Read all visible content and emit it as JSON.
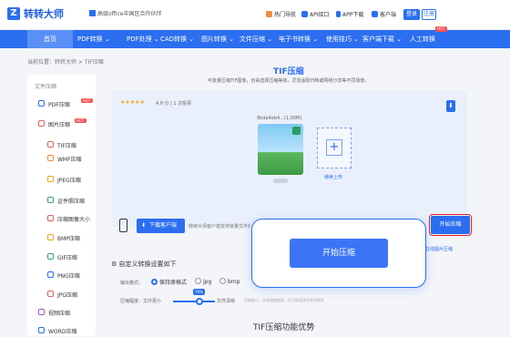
{
  "topbar": {
    "logo_text": "转转大师",
    "partner_text": "高级office中国区合作伙伴",
    "links": [
      "热门导航",
      "API接口",
      "APP下载",
      "客户端"
    ],
    "login": "登录",
    "register": "注册"
  },
  "nav": {
    "items": [
      "首页",
      "PDF转换",
      "PDF处理",
      "CAD转换",
      "图片转换",
      "文件压缩",
      "电子书转换",
      "使用技巧",
      "客户端下载",
      "人工转换"
    ],
    "hot_badge": "HOT"
  },
  "breadcrumb": "当前位置：转转大师 > TIF压缩",
  "sidebar": {
    "head": "文件压缩",
    "items": [
      {
        "label": "PDF压缩",
        "badge": "HOT",
        "color": "#2b6ef0"
      },
      {
        "label": "图片压缩",
        "badge": "HOT",
        "color": "#e0605a"
      },
      {
        "label": "TIF压缩",
        "badge": "",
        "color": "#e0605a"
      },
      {
        "label": "WMF压缩",
        "badge": "",
        "color": "#f08c3c"
      },
      {
        "label": "JPEG压缩",
        "badge": "",
        "color": "#f0a41c"
      },
      {
        "label": "证件照压缩",
        "badge": "",
        "color": "#2aa876"
      },
      {
        "label": "压缩图像大小",
        "badge": "",
        "color": "#e0605a"
      },
      {
        "label": "BMP压缩",
        "badge": "",
        "color": "#f0a41c"
      },
      {
        "label": "GIF压缩",
        "badge": "",
        "color": "#2aa876"
      },
      {
        "label": "PNG压缩",
        "badge": "",
        "color": "#2b6ef0"
      },
      {
        "label": "JPG压缩",
        "badge": "",
        "color": "#e0605a"
      },
      {
        "label": "视频压缩",
        "badge": "",
        "color": "#9b59d6"
      },
      {
        "label": "WORD压缩",
        "badge": "",
        "color": "#2b6ef0"
      }
    ]
  },
  "main": {
    "title": "TIF压缩",
    "subtitle": "可批量压缩TIF图像，自由选择压缩等级，灵活适配归档或网络分享等不同场景。",
    "stars": "★★★★★",
    "rating": "4.9 分 | 1 次投票",
    "file_name": "8bda4eb4...(1.00M)",
    "add_label": "继续上传",
    "download_client": "下载客户端",
    "download_desc": "转转大师客户端支持批量文件处理",
    "start_small": "开始压缩",
    "side_link": "在线图片压缩",
    "start_big": "开始压缩",
    "settings_title": "自定义转换设置如下",
    "format_label": "输出格式：",
    "format_options": [
      "保持原格式",
      "jpg",
      "bmp"
    ],
    "selected_format": "保持原格式",
    "level_label": "压缩程度：",
    "level_low": "文件更小",
    "level_high": "文件清晰",
    "level_value": "70%",
    "level_hint": "压缩越小，压缩速度越快，但可能画质会有所降低",
    "feature_title": "TIF压缩功能优势"
  }
}
